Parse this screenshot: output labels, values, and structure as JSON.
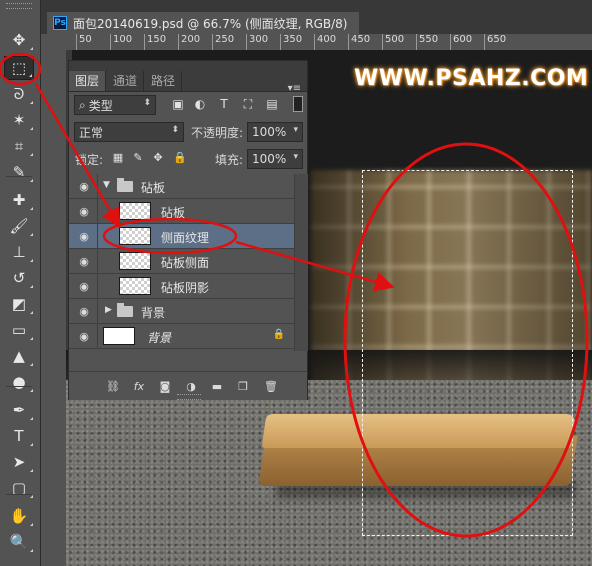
{
  "app": {
    "ps_badge": "Ps"
  },
  "document": {
    "tab_title": "面包20140619.psd @ 66.7% (侧面纹理, RGB/8)"
  },
  "ruler": {
    "ticks": [
      "50",
      "100",
      "150",
      "200",
      "250",
      "300",
      "350",
      "400",
      "450",
      "500",
      "550",
      "600",
      "650"
    ]
  },
  "toolbar": {
    "tools": [
      {
        "name": "move-tool",
        "icon": "move-icon",
        "glyph": "✥"
      },
      {
        "name": "rectangular-marquee-tool",
        "icon": "marquee-icon",
        "glyph": "⬚"
      },
      {
        "name": "lasso-tool",
        "icon": "lasso-icon",
        "glyph": "ᘐ"
      },
      {
        "name": "magic-wand-tool",
        "icon": "magic-wand-icon",
        "glyph": "✶"
      },
      {
        "name": "crop-tool",
        "icon": "crop-icon",
        "glyph": "⌗"
      },
      {
        "name": "eyedropper-tool",
        "icon": "eyedropper-icon",
        "glyph": "✎"
      },
      {
        "name": "healing-brush-tool",
        "icon": "bandage-icon",
        "glyph": "✚"
      },
      {
        "name": "brush-tool",
        "icon": "brush-icon",
        "glyph": "🖌"
      },
      {
        "name": "clone-stamp-tool",
        "icon": "stamp-icon",
        "glyph": "⊥"
      },
      {
        "name": "history-brush-tool",
        "icon": "history-brush-icon",
        "glyph": "↺"
      },
      {
        "name": "eraser-tool",
        "icon": "eraser-icon",
        "glyph": "◩"
      },
      {
        "name": "gradient-tool",
        "icon": "gradient-icon",
        "glyph": "▭"
      },
      {
        "name": "blur-tool",
        "icon": "blur-icon",
        "glyph": "▲"
      },
      {
        "name": "dodge-tool",
        "icon": "dodge-icon",
        "glyph": "●"
      },
      {
        "name": "pen-tool",
        "icon": "pen-icon",
        "glyph": "✒"
      },
      {
        "name": "type-tool",
        "icon": "type-icon",
        "glyph": "T"
      },
      {
        "name": "path-selection-tool",
        "icon": "path-selection-icon",
        "glyph": "➤"
      },
      {
        "name": "shape-tool",
        "icon": "rounded-rect-icon",
        "glyph": "▢"
      },
      {
        "name": "hand-tool",
        "icon": "hand-icon",
        "glyph": "✋"
      },
      {
        "name": "zoom-tool",
        "icon": "zoom-icon",
        "glyph": "🔍"
      }
    ]
  },
  "layers_panel": {
    "tabs": [
      "图层",
      "通道",
      "路径"
    ],
    "filter_kind": "类型",
    "blend_mode": "正常",
    "opacity_label": "不透明度:",
    "opacity_value": "100%",
    "lock_label": "锁定:",
    "fill_label": "填充:",
    "fill_value": "100%",
    "layers": [
      {
        "name": "砧板",
        "type": "group",
        "expanded": true
      },
      {
        "name": "砧板",
        "type": "layer"
      },
      {
        "name": "侧面纹理",
        "type": "layer",
        "selected": true
      },
      {
        "name": "砧板侧面",
        "type": "layer"
      },
      {
        "name": "砧板阴影",
        "type": "layer"
      },
      {
        "name": "背景",
        "type": "group",
        "expanded": false
      },
      {
        "name": "背景",
        "type": "background",
        "locked": true
      }
    ]
  },
  "canvas": {
    "watermark": "WWW.PSAHZ.COM"
  },
  "colors": {
    "annotation_red": "#e01010",
    "selection_blue": "#5d6f86"
  }
}
